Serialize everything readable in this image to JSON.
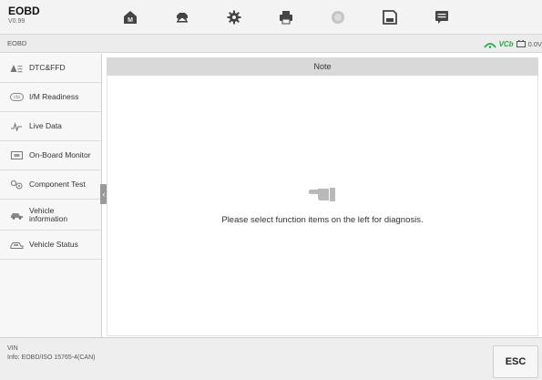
{
  "app": {
    "title": "EOBD",
    "version": "V0.99"
  },
  "toolbar": [
    {
      "icon": "home-icon"
    },
    {
      "icon": "vehicle-lift-icon"
    },
    {
      "icon": "settings-gear-icon"
    },
    {
      "icon": "print-icon"
    },
    {
      "icon": "help-icon"
    },
    {
      "icon": "save-icon"
    },
    {
      "icon": "message-icon"
    }
  ],
  "breadcrumb": "EOBD",
  "status": {
    "vci": "VCb",
    "battery": "0.0V"
  },
  "sidebar": {
    "items": [
      {
        "label": "DTC&FFD",
        "icon": "dtc-warning-icon"
      },
      {
        "label": "I/M Readiness",
        "icon": "im-readiness-icon"
      },
      {
        "label": "Live Data",
        "icon": "live-data-icon"
      },
      {
        "label": "On-Board Monitor",
        "icon": "monitor-icon"
      },
      {
        "label": "Component Test",
        "icon": "component-test-icon"
      },
      {
        "label": "Vehicle information",
        "icon": "vehicle-info-icon"
      },
      {
        "label": "Vehicle Status",
        "icon": "vehicle-status-icon"
      }
    ]
  },
  "main": {
    "header": "Note",
    "message": "Please select function items on the left for diagnosis."
  },
  "footer": {
    "vin_label": "VIN",
    "info": "Info: EOBD/ISO 15765-4(CAN)",
    "esc_label": "ESC"
  },
  "colors": {
    "topbar": "#f3f3f3",
    "accent_green": "#27a745",
    "icon_gray": "#555555"
  }
}
